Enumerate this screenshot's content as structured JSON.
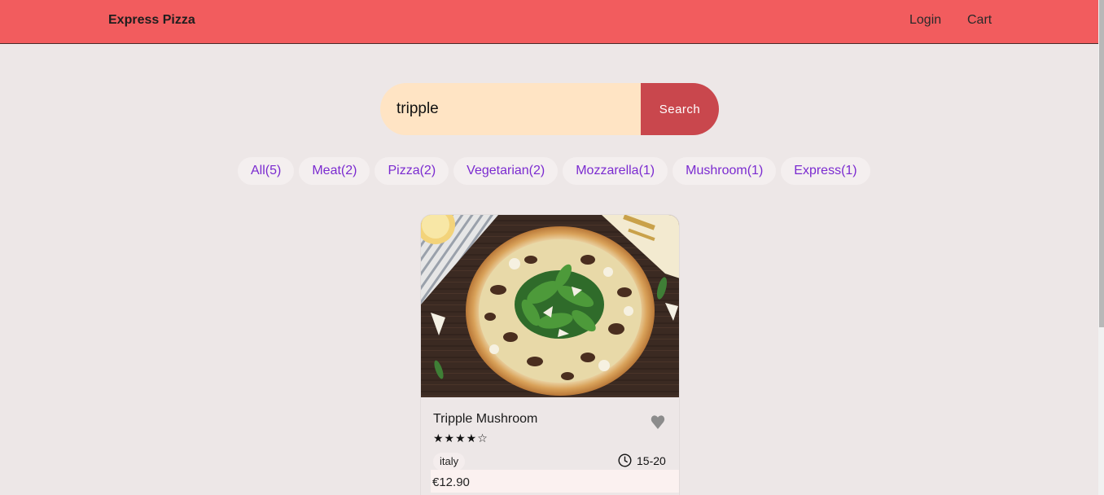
{
  "header": {
    "brand": "Express Pizza",
    "nav": {
      "login": "Login",
      "cart": "Cart"
    }
  },
  "search": {
    "value": "tripple",
    "button_label": "Search"
  },
  "tags": [
    "All(5)",
    "Meat(2)",
    "Pizza(2)",
    "Vegetarian(2)",
    "Mozzarella(1)",
    "Mushroom(1)",
    "Express(1)"
  ],
  "food": {
    "name": "Tripple Mushroom",
    "stars": "★★★★☆",
    "origin": "italy",
    "cook_time": "15-20",
    "price": "€12.90"
  },
  "colors": {
    "header": "#f25c5e",
    "search_input": "#ffe4c4",
    "search_button": "#c9474d",
    "tag_text": "#7b2bd0",
    "background": "#ede7e7"
  }
}
